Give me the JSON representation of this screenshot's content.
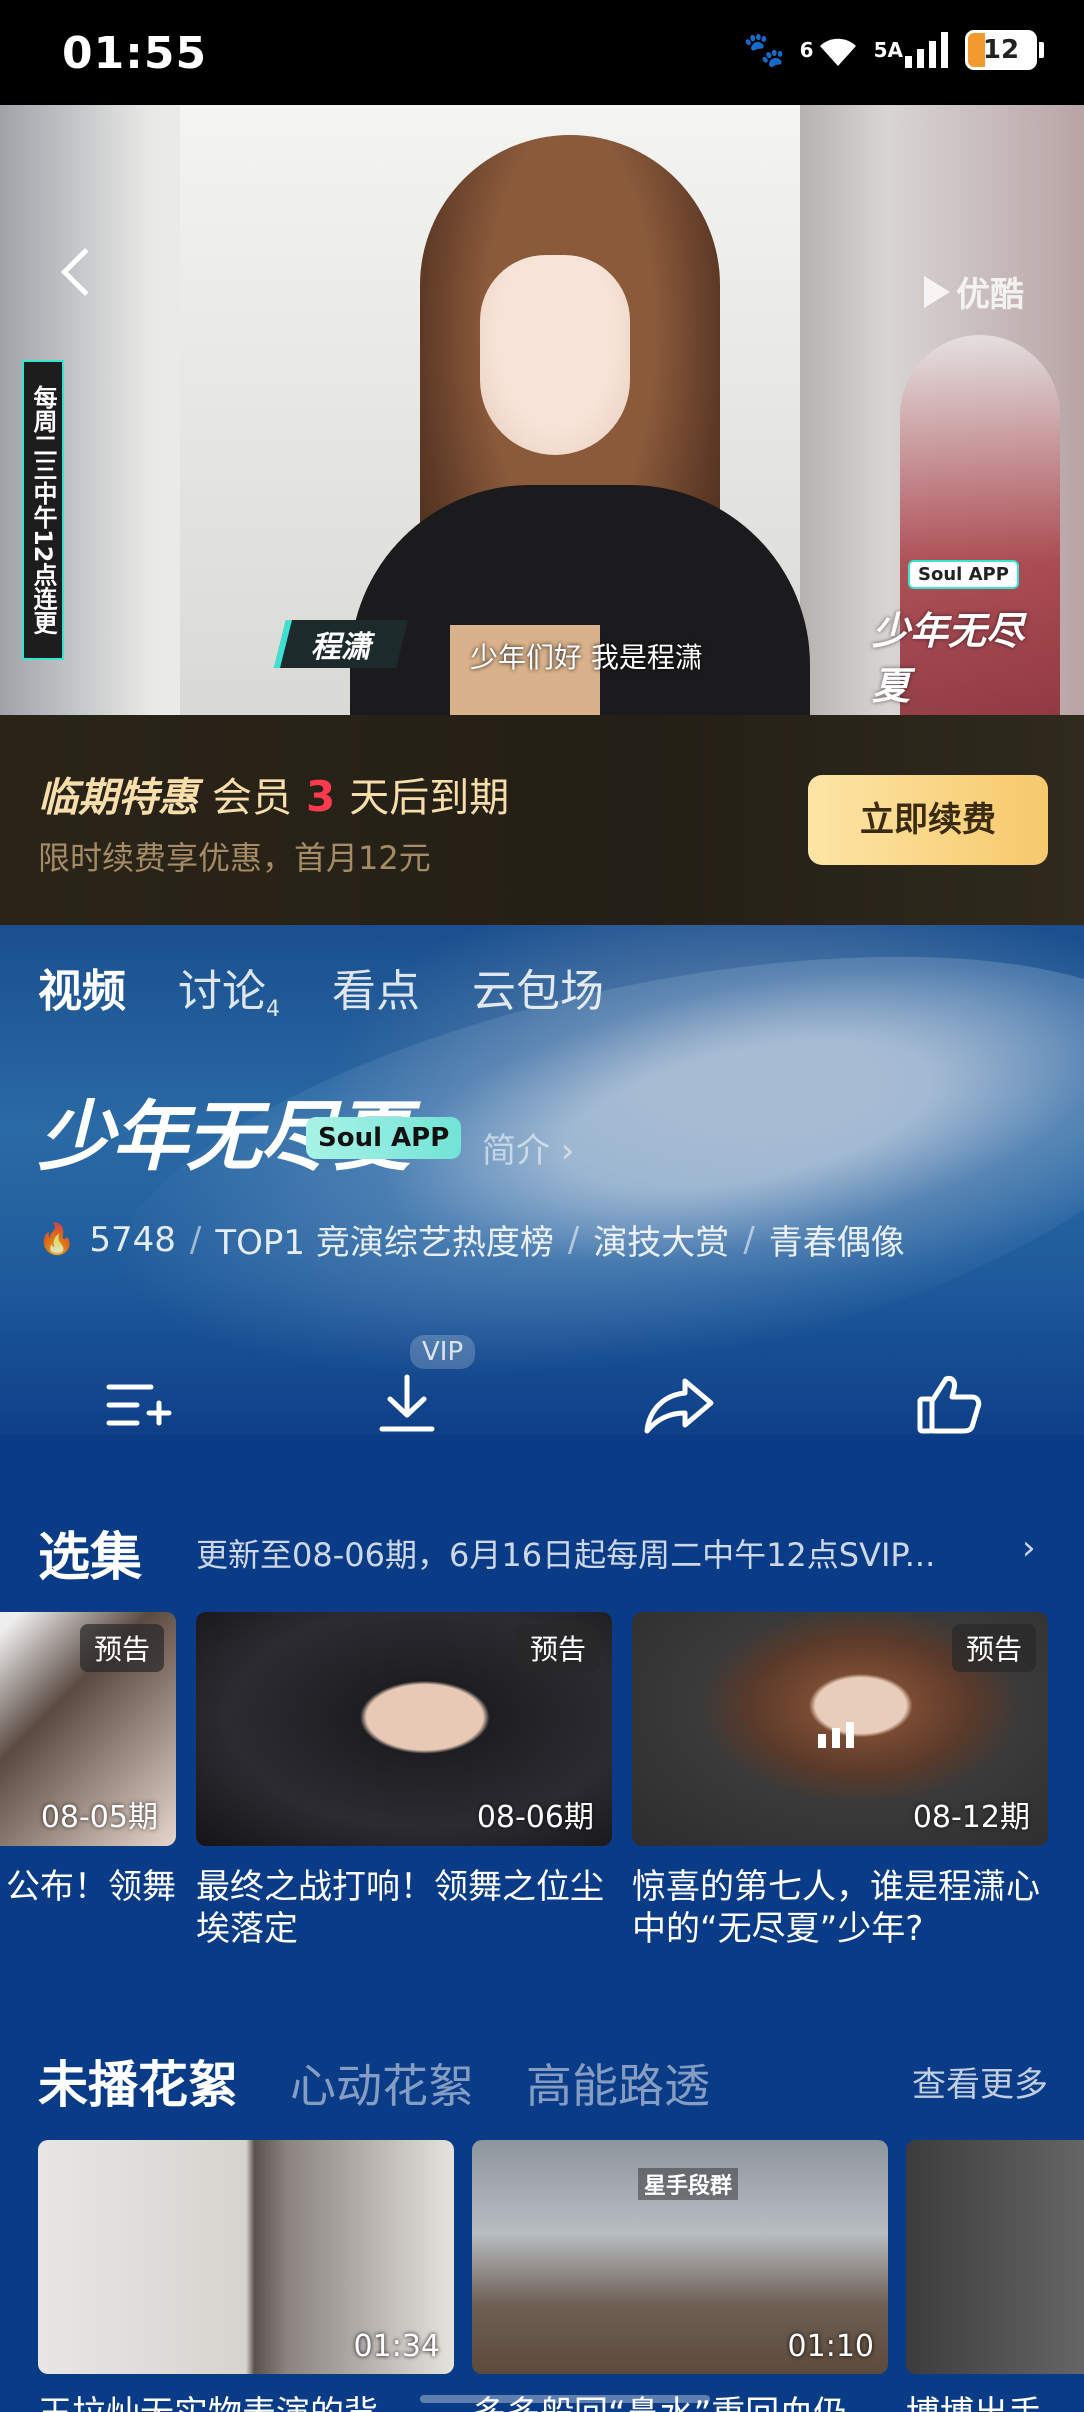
{
  "status_bar": {
    "time": "01:55",
    "network_labels": [
      "6",
      "5A"
    ],
    "battery_level": "12"
  },
  "video": {
    "brand": "优酷",
    "side_tag": "每周二三中午12点连更",
    "caption_name": "程潇",
    "caption_text": "少年们好 我是程潇",
    "soul_badge_small": "Soul APP",
    "show_logo_small": "少年无尽夏"
  },
  "vip_banner": {
    "title_strong": "临期特惠",
    "title_pre": "会员",
    "days": "3",
    "title_post": "天后到期",
    "subtitle": "限时续费享优惠，首月12元",
    "button": "立即续费"
  },
  "tabs": [
    {
      "label": "视频",
      "active": true
    },
    {
      "label": "讨论",
      "count": "4"
    },
    {
      "label": "看点"
    },
    {
      "label": "云包场"
    }
  ],
  "show": {
    "title": "少年无尽夏",
    "soul_badge": "Soul APP",
    "intro_link": "简介 ›",
    "heat": "5748",
    "tags": [
      "TOP1 竞演综艺热度榜",
      "演技大赏",
      "青春偶像"
    ],
    "download_badge": "VIP"
  },
  "episodes": {
    "title": "选集",
    "update_info": "更新至08-06期，6月16日起每周二中午12点SVIP...",
    "items": [
      {
        "tag": "预告",
        "number": "08-05期",
        "caption": "公布！领舞"
      },
      {
        "tag": "预告",
        "number": "08-06期",
        "caption": "最终之战打响！领舞之位尘埃落定"
      },
      {
        "tag": "预告",
        "number": "08-12期",
        "caption": "惊喜的第七人，谁是程潇心中的“无尽夏”少年?"
      }
    ]
  },
  "clips": {
    "tabs": [
      "未播花絮",
      "心动花絮",
      "高能路透"
    ],
    "see_more": "查看更多",
    "items": [
      {
        "duration": "01:34",
        "caption": "王拉灿无实物表演的背"
      },
      {
        "duration": "01:10",
        "caption": "多多般回“鼻水”重回血仍",
        "overlay_tag": "星手段群"
      },
      {
        "duration": "",
        "caption": "博博出手"
      }
    ]
  },
  "colors": {
    "page_bg": "#0a3b86",
    "vip_gold": "#f7deaa",
    "days_red": "#ff3a4f",
    "button_gold": "#f6c96b",
    "accent_teal": "#39e3d2"
  },
  "icons": [
    "back-icon",
    "youku-logo-icon",
    "flame-icon",
    "add-to-playlist-icon",
    "download-icon",
    "share-icon",
    "like-icon",
    "chevron-right-icon",
    "wifi-icon",
    "signal-icon",
    "battery-icon",
    "paw-icon"
  ]
}
